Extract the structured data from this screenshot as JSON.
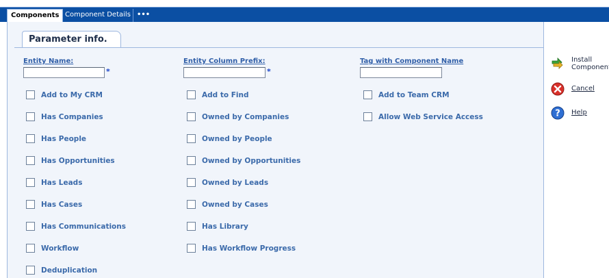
{
  "tabs": {
    "components": "Components",
    "component_details": "Component Details",
    "more": "•••"
  },
  "section": {
    "title": "Parameter info."
  },
  "fields": {
    "entity_name": {
      "label": "Entity Name:",
      "value": "",
      "required_mark": "*"
    },
    "entity_column_prefix": {
      "label": "Entity Column Prefix:",
      "value": "",
      "required_mark": "*"
    },
    "tag_with_component_name": {
      "label": "Tag with Component Name",
      "value": ""
    }
  },
  "checkboxes": {
    "col1": [
      {
        "label": "Add to My CRM",
        "checked": false
      },
      {
        "label": "Has Companies",
        "checked": false
      },
      {
        "label": "Has People",
        "checked": false
      },
      {
        "label": "Has Opportunities",
        "checked": false
      },
      {
        "label": "Has Leads",
        "checked": false
      },
      {
        "label": "Has Cases",
        "checked": false
      },
      {
        "label": "Has Communications",
        "checked": false
      },
      {
        "label": "Workflow",
        "checked": false
      },
      {
        "label": "Deduplication",
        "checked": false
      }
    ],
    "col2": [
      {
        "label": "Add to Find",
        "checked": false
      },
      {
        "label": "Owned by Companies",
        "checked": false
      },
      {
        "label": "Owned by People",
        "checked": false
      },
      {
        "label": "Owned by Opportunities",
        "checked": false
      },
      {
        "label": "Owned by Leads",
        "checked": false
      },
      {
        "label": "Owned by Cases",
        "checked": false
      },
      {
        "label": "Has Library",
        "checked": false
      },
      {
        "label": "Has Workflow Progress",
        "checked": false
      }
    ],
    "col3": [
      {
        "label": "Add to Team CRM",
        "checked": false
      },
      {
        "label": "Allow Web Service Access",
        "checked": false
      }
    ]
  },
  "actions": {
    "install": {
      "label": "Install\nComponent",
      "icon": "install-arrows-icon"
    },
    "cancel": {
      "label": "Cancel",
      "icon": "cancel-x-icon"
    },
    "help": {
      "label": "Help",
      "icon": "help-question-icon"
    }
  },
  "colors": {
    "tabbar": "#0b4fa3",
    "panel": "#f1f5fb",
    "label_blue": "#3b6aaa",
    "required": "#1a44c9"
  }
}
